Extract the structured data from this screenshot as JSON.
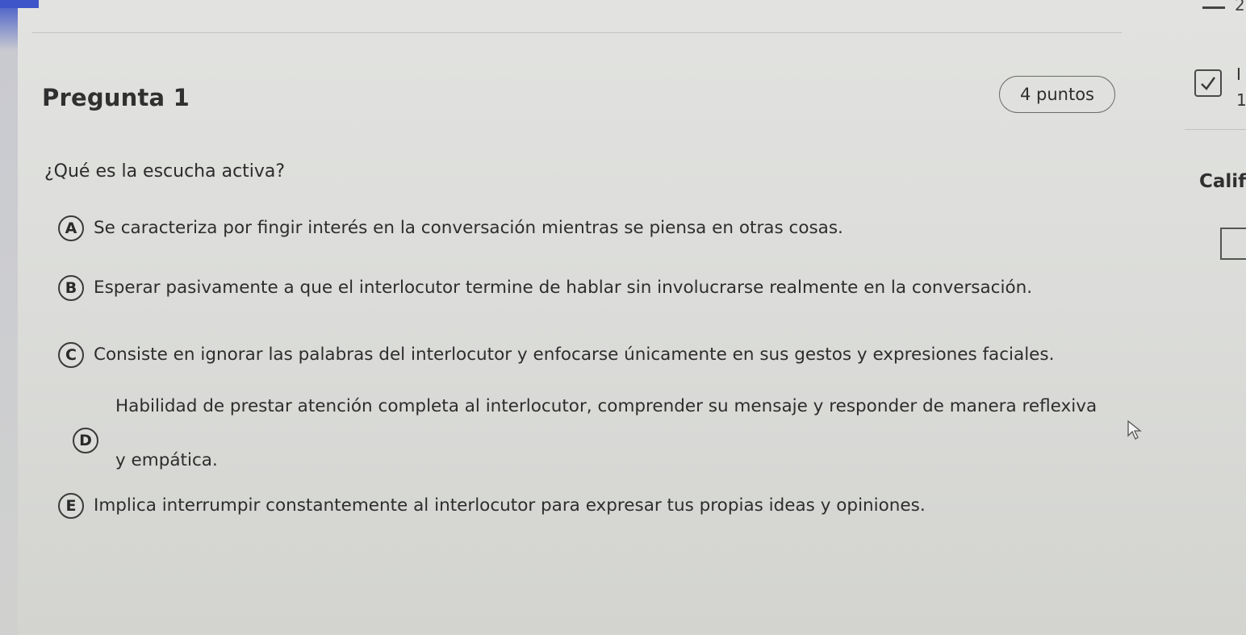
{
  "question": {
    "title": "Pregunta 1",
    "points": "4 puntos",
    "text": "¿Qué es la escucha activa?"
  },
  "options": [
    {
      "letter": "A",
      "text": "Se caracteriza por fingir interés en la conversación mientras se piensa en otras cosas."
    },
    {
      "letter": "B",
      "text": "Esperar pasivamente a que el interlocutor termine de hablar sin involucrarse realmente en la conversación."
    },
    {
      "letter": "C",
      "text": "Consiste en ignorar las palabras del interlocutor y enfocarse únicamente en sus gestos y expresiones faciales."
    },
    {
      "letter": "D",
      "text_line1": "Habilidad de prestar atención completa al interlocutor, comprender su mensaje y responder de manera reflexiva",
      "text_line2": "y empática."
    },
    {
      "letter": "E",
      "text": "Implica interrumpir constantemente al interlocutor para expresar tus propias ideas y opiniones."
    }
  ],
  "side_panel": {
    "label": "Calific",
    "cut_text_1": "I",
    "cut_text_2": "1",
    "corner_num": "2"
  },
  "icons": {
    "check": "checkbox-checked-icon",
    "cursor": "mouse-pointer-icon"
  },
  "colors": {
    "accent": "#3d55c8"
  }
}
